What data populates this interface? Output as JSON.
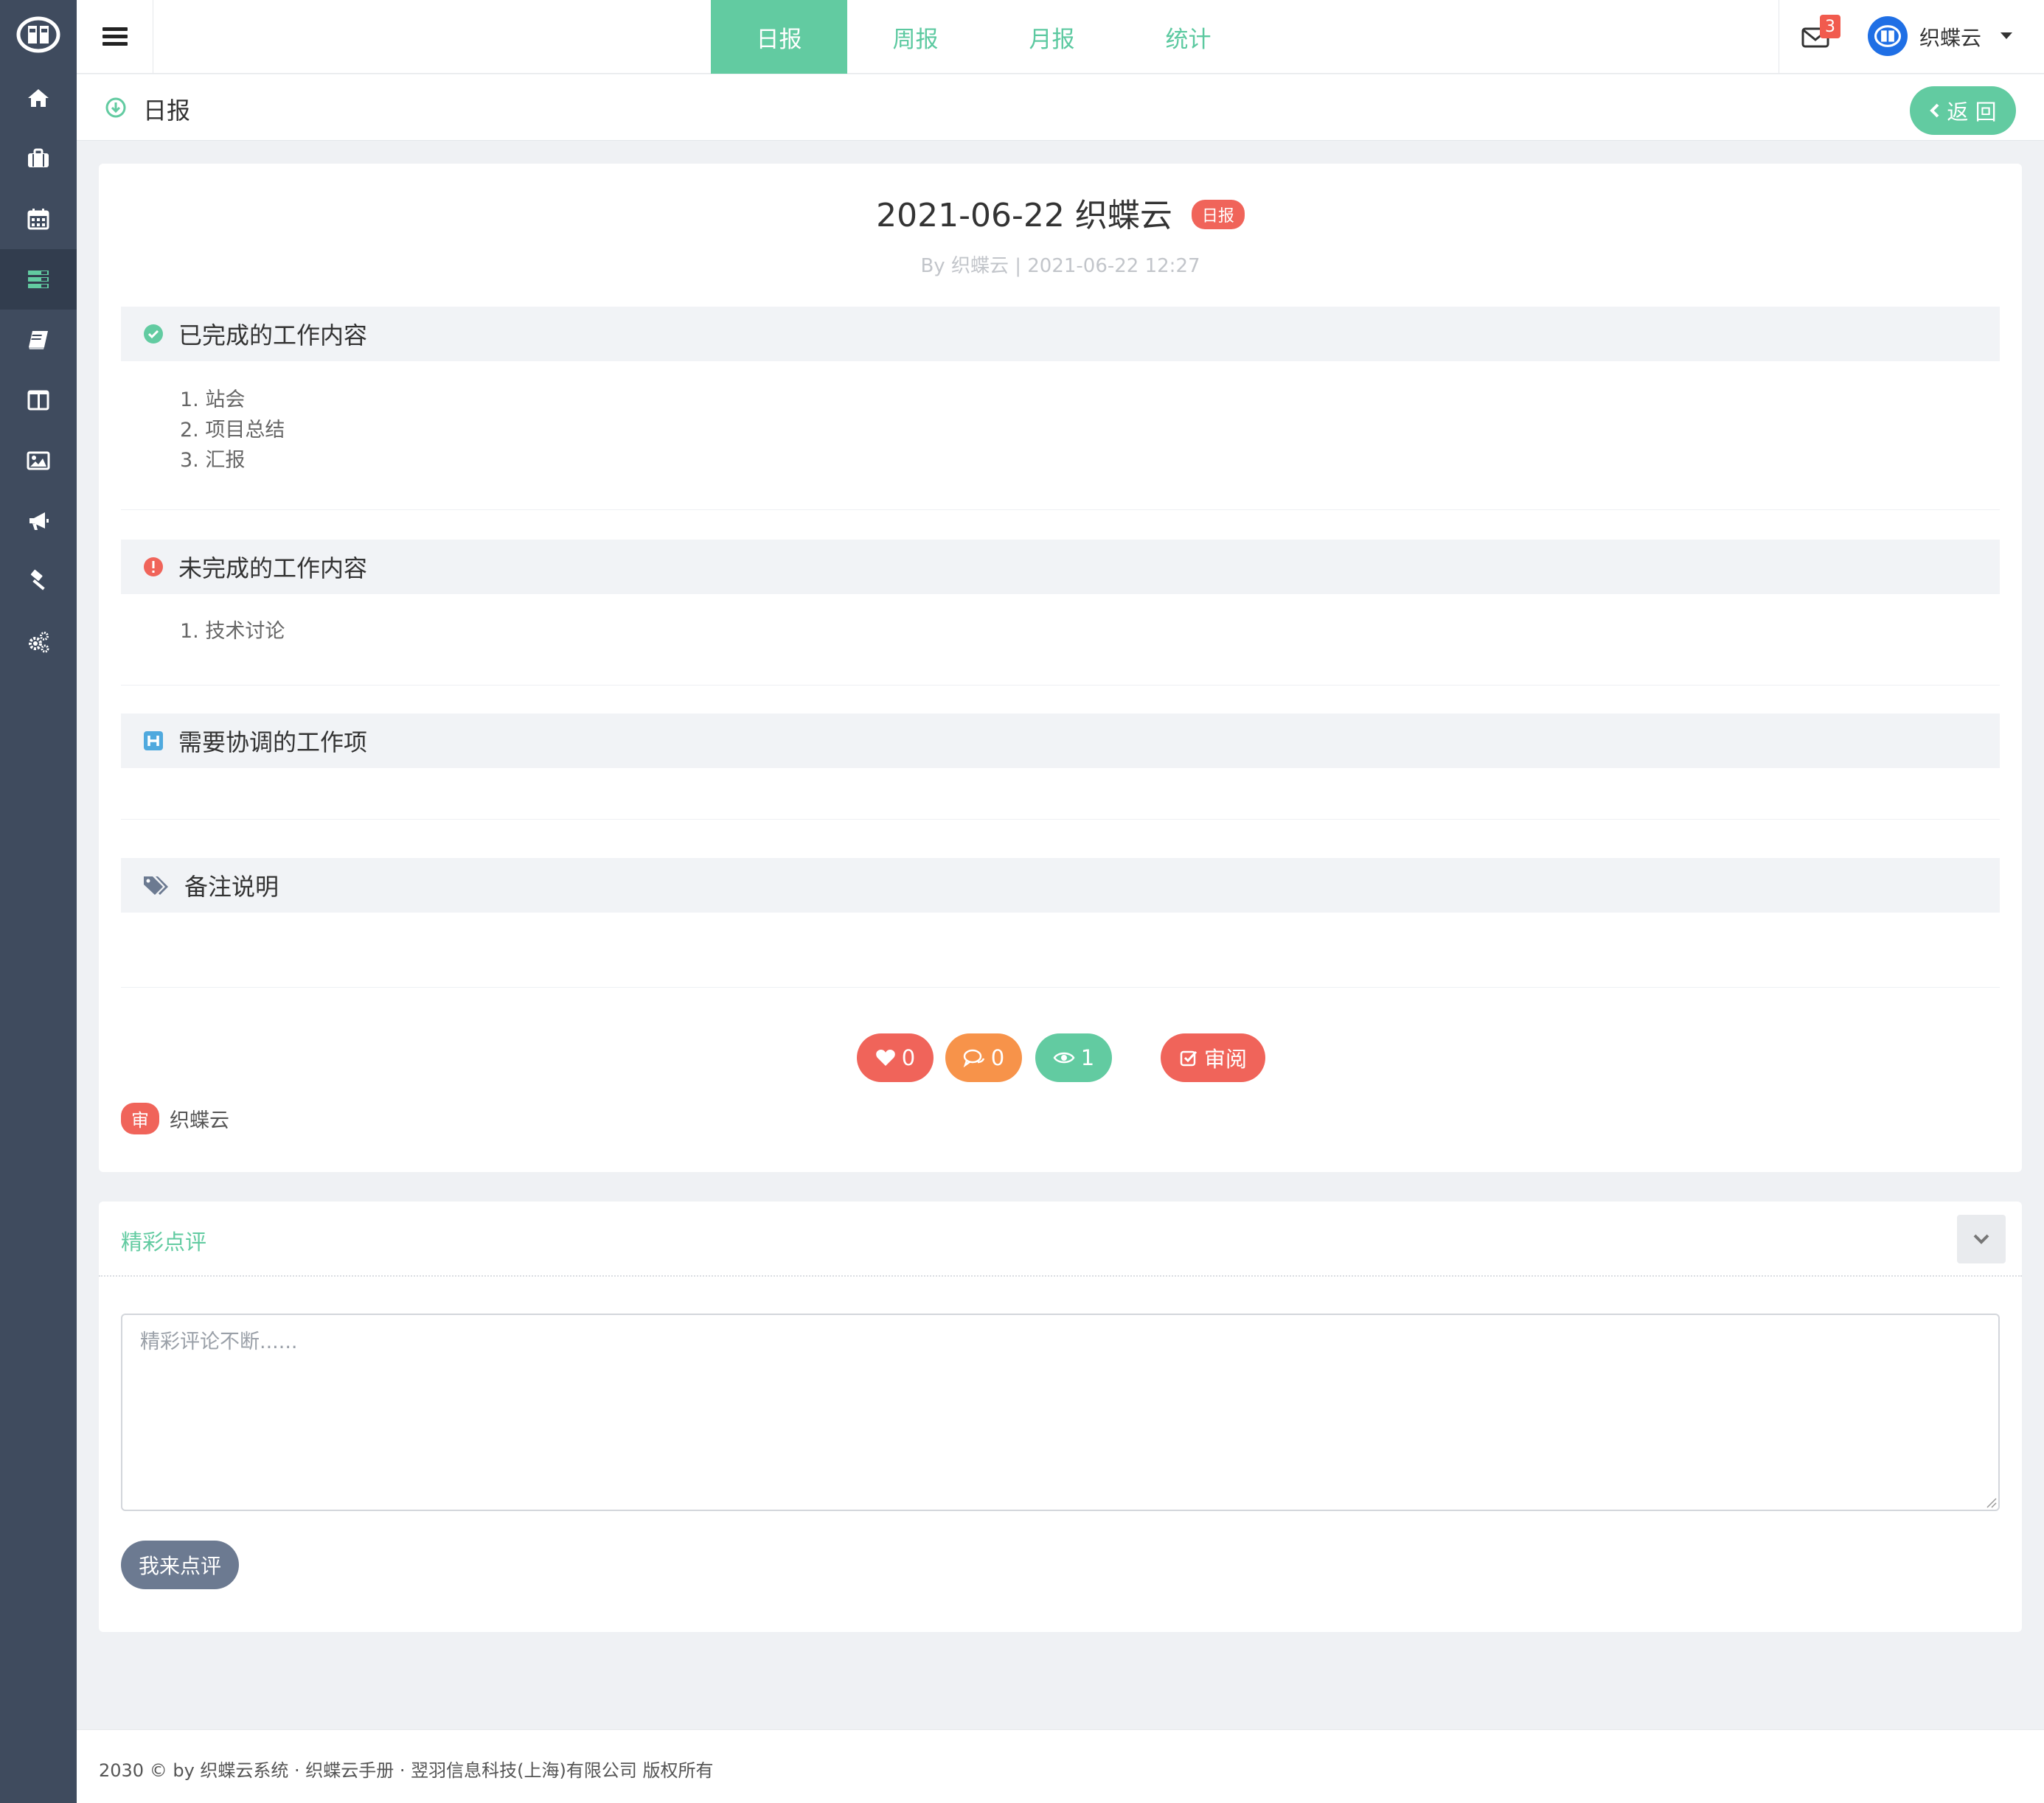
{
  "nav": {
    "tabs": [
      "日报",
      "周报",
      "月报",
      "统计"
    ],
    "active_tab": 0,
    "mail_count": "3",
    "user_name": "织蝶云"
  },
  "sidebar": {
    "items": [
      "home-icon",
      "briefcase-icon",
      "calendar-icon",
      "report-list-icon",
      "book-icon",
      "columns-icon",
      "image-icon",
      "bullhorn-icon",
      "gavel-icon",
      "cogs-icon"
    ],
    "active_index": 3
  },
  "breadcrumb": {
    "title": "日报",
    "back_label": "返 回"
  },
  "report": {
    "title": "2021-06-22 织蝶云",
    "tag": "日报",
    "meta": "By 织蝶云 | 2021-06-22 12:27",
    "sections": [
      {
        "title": "已完成的工作内容",
        "items": [
          "1. 站会",
          "2. 项目总结",
          "3. 汇报"
        ]
      },
      {
        "title": "未完成的工作内容",
        "items": [
          "1. 技术讨论"
        ]
      },
      {
        "title": "需要协调的工作项",
        "items": []
      },
      {
        "title": "备注说明",
        "items": []
      }
    ],
    "likes": "0",
    "comments": "0",
    "views": "1",
    "review_label": "审阅",
    "reviewer_badge": "审",
    "reviewer_name": "织蝶云"
  },
  "comments": {
    "title": "精彩点评",
    "placeholder": "精彩评论不断......",
    "submit_label": "我来点评"
  },
  "footer": {
    "text": "2030 © by 织蝶云系统 · 织蝶云手册 · 翌羽信息科技(上海)有限公司 版权所有"
  },
  "colors": {
    "primary": "#62cba1",
    "danger": "#f0645a",
    "warning": "#f7934a",
    "sidebar": "#3f4b5e"
  }
}
